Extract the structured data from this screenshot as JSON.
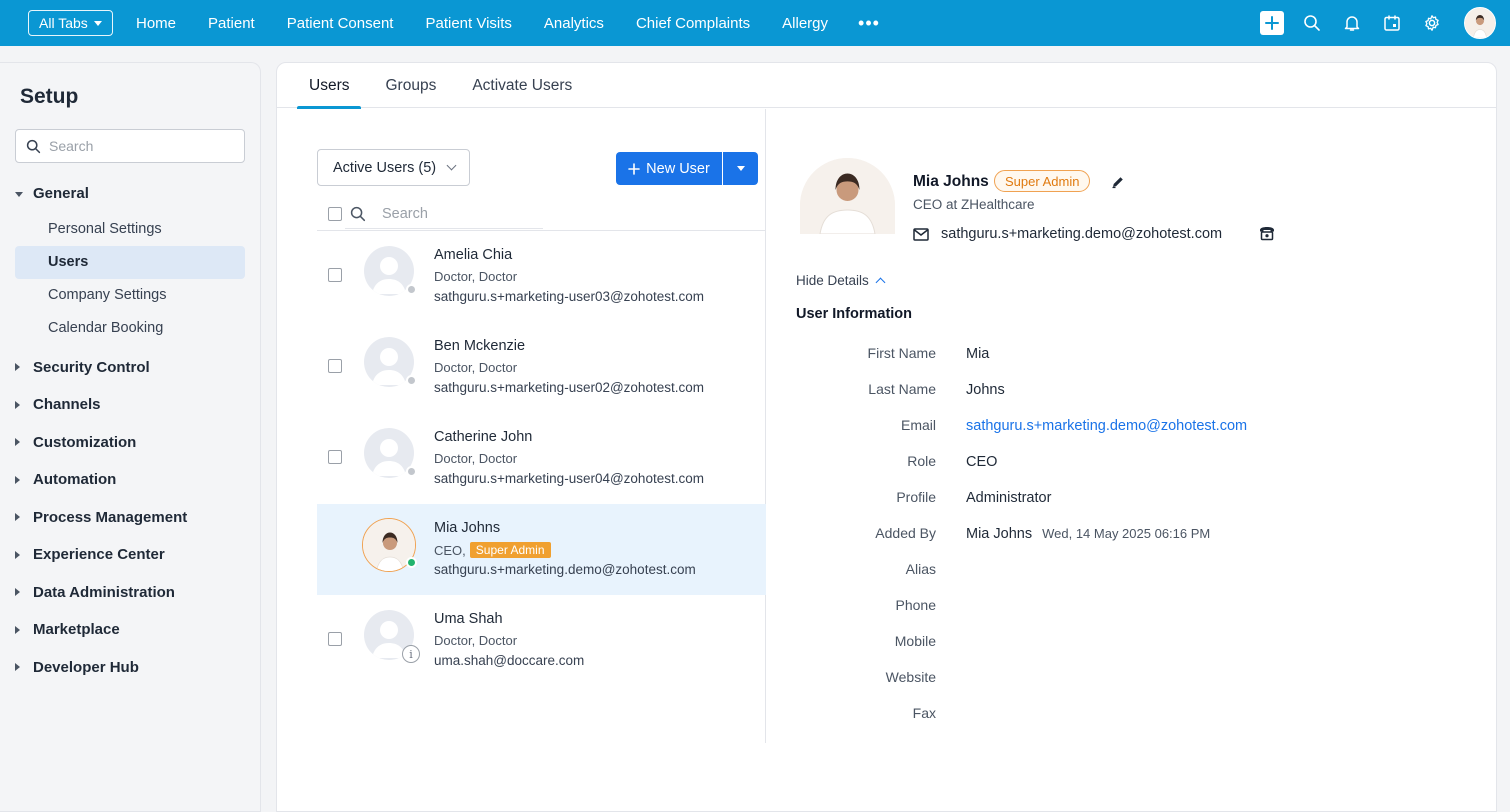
{
  "topbar": {
    "all_tabs_label": "All Tabs",
    "nav": [
      "Home",
      "Patient",
      "Patient Consent",
      "Patient Visits",
      "Analytics",
      "Chief Complaints",
      "Allergy"
    ],
    "more_label": "•••",
    "icons": [
      "plus-icon",
      "search-icon",
      "bell-icon",
      "calendar-icon",
      "gear-icon",
      "user-avatar"
    ],
    "accent_color": "#0a97d3"
  },
  "sidebar": {
    "title": "Setup",
    "search_placeholder": "Search",
    "sections": [
      {
        "label": "General",
        "expanded": true,
        "items": [
          "Personal Settings",
          "Users",
          "Company Settings",
          "Calendar Booking"
        ],
        "active_item": "Users"
      },
      {
        "label": "Security Control"
      },
      {
        "label": "Channels"
      },
      {
        "label": "Customization"
      },
      {
        "label": "Automation"
      },
      {
        "label": "Process Management"
      },
      {
        "label": "Experience Center"
      },
      {
        "label": "Data Administration"
      },
      {
        "label": "Marketplace"
      },
      {
        "label": "Developer Hub"
      }
    ]
  },
  "tabs": [
    "Users",
    "Groups",
    "Activate Users"
  ],
  "list": {
    "filter_label": "Active Users (5)",
    "new_user_label": "New User",
    "search_placeholder": "Search",
    "users": [
      {
        "name": "Amelia Chia",
        "role": "Doctor, Doctor",
        "email": "sathguru.s+marketing-user03@zohotest.com",
        "status": "offline"
      },
      {
        "name": "Ben Mckenzie",
        "role": "Doctor, Doctor",
        "email": "sathguru.s+marketing-user02@zohotest.com",
        "status": "offline"
      },
      {
        "name": "Catherine John",
        "role": "Doctor, Doctor",
        "email": "sathguru.s+marketing-user04@zohotest.com",
        "status": "offline"
      },
      {
        "name": "Mia Johns",
        "role": "CEO,",
        "tag": "Super Admin",
        "email": "sathguru.s+marketing.demo@zohotest.com",
        "status": "online",
        "selected": true
      },
      {
        "name": "Uma Shah",
        "role": "Doctor, Doctor",
        "email": "uma.shah@doccare.com",
        "status": "info"
      }
    ]
  },
  "detail": {
    "name": "Mia Johns",
    "badge": "Super Admin",
    "subtitle": "CEO  at  ZHealthcare",
    "email": "sathguru.s+marketing.demo@zohotest.com",
    "hide_details_label": "Hide Details",
    "section_title": "User Information",
    "fields": {
      "first_name": {
        "label": "First Name",
        "value": "Mia"
      },
      "last_name": {
        "label": "Last Name",
        "value": "Johns"
      },
      "email": {
        "label": "Email",
        "value": "sathguru.s+marketing.demo@zohotest.com"
      },
      "role": {
        "label": "Role",
        "value": "CEO"
      },
      "profile": {
        "label": "Profile",
        "value": "Administrator"
      },
      "added_by": {
        "label": "Added By",
        "value": "Mia Johns",
        "timestamp": "Wed, 14 May 2025 06:16 PM"
      },
      "alias": {
        "label": "Alias"
      },
      "phone": {
        "label": "Phone"
      },
      "mobile": {
        "label": "Mobile"
      },
      "website": {
        "label": "Website"
      },
      "fax": {
        "label": "Fax"
      }
    }
  }
}
